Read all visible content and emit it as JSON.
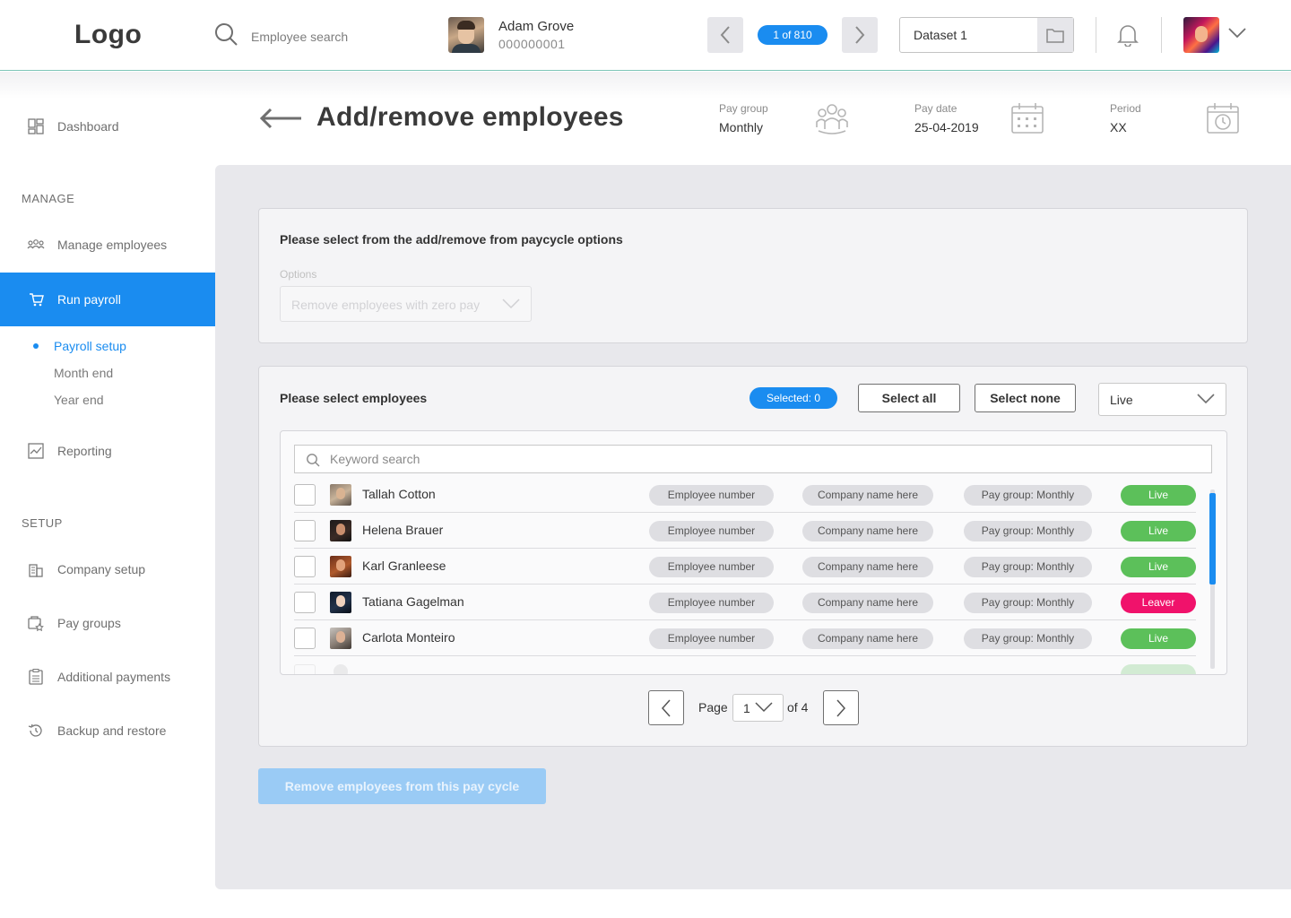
{
  "app": {
    "logo": "Logo"
  },
  "topbar": {
    "search_placeholder": "Employee search",
    "employee": {
      "name": "Adam Grove",
      "number": "000000001"
    },
    "counter": "1 of 810",
    "dataset": "Dataset 1"
  },
  "sidebar": {
    "dashboard": "Dashboard",
    "manage_heading": "MANAGE",
    "manage_employees": "Manage employees",
    "run_payroll": "Run payroll",
    "sub": {
      "payroll_setup": "Payroll setup",
      "month_end": "Month end",
      "year_end": "Year end"
    },
    "reporting": "Reporting",
    "setup_heading": "SETUP",
    "company_setup": "Company setup",
    "pay_groups": "Pay groups",
    "additional_payments": "Additional payments",
    "backup_restore": "Backup and restore"
  },
  "header": {
    "title": "Add/remove employees",
    "pay_group": {
      "label": "Pay group",
      "value": "Monthly"
    },
    "pay_date": {
      "label": "Pay date",
      "value": "25-04-2019"
    },
    "period": {
      "label": "Period",
      "value": "XX"
    }
  },
  "options_card": {
    "title": "Please select from the add/remove from paycycle options",
    "options_label": "Options",
    "options_value": "Remove employees with zero pay"
  },
  "employees_card": {
    "title": "Please select employees",
    "selected": "Selected: 0",
    "select_all": "Select all",
    "select_none": "Select none",
    "filter": "Live",
    "keyword_placeholder": "Keyword search",
    "rows": [
      {
        "name": "Tallah Cotton",
        "number": "Employee number",
        "company": "Company name here",
        "paygroup": "Pay group: Monthly",
        "status": "Live"
      },
      {
        "name": "Helena Brauer",
        "number": "Employee number",
        "company": "Company name here",
        "paygroup": "Pay group: Monthly",
        "status": "Live"
      },
      {
        "name": "Karl Granleese",
        "number": "Employee number",
        "company": "Company name here",
        "paygroup": "Pay group: Monthly",
        "status": "Live"
      },
      {
        "name": "Tatiana Gagelman",
        "number": "Employee number",
        "company": "Company name here",
        "paygroup": "Pay group: Monthly",
        "status": "Leaver"
      },
      {
        "name": "Carlota Monteiro",
        "number": "Employee number",
        "company": "Company name here",
        "paygroup": "Pay group: Monthly",
        "status": "Live"
      }
    ],
    "pagination": {
      "page_label": "Page",
      "page": "1",
      "of_label": "of 4"
    }
  },
  "primary_action": "Remove employees from this pay cycle",
  "colors": {
    "accent": "#1a8cf0",
    "live": "#5cc05a",
    "leaver": "#f0126b",
    "disabled_btn": "#9acbf5"
  }
}
